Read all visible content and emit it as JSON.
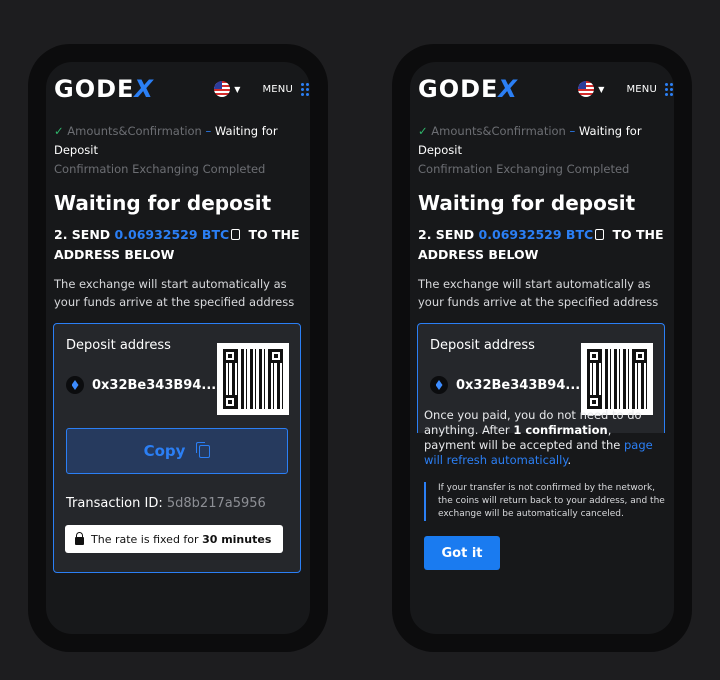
{
  "brand": {
    "logo_main": "GODE",
    "logo_accent": "X"
  },
  "header": {
    "menu_label": "MENU",
    "language_flag": "us-flag-icon"
  },
  "steps": {
    "step1": "Amounts&Confirmation",
    "step2": "Waiting for Deposit",
    "step3": "Confirmation",
    "step4": "Exchanging",
    "step5": "Completed"
  },
  "page": {
    "title": "Waiting for deposit",
    "send_prefix": "2. SEND",
    "amount": "0.06932529 BTC",
    "send_suffix": "TO THE",
    "send_suffix2": "ADDRESS BELOW",
    "description": "The exchange will start automatically as your funds arrive at the specified address"
  },
  "deposit": {
    "label": "Deposit address",
    "address": "0x32Be343B94...",
    "copy_label": "Copy",
    "tx_label": "Transaction ID:",
    "tx_value": "5d8b217a5956",
    "rate_prefix": "The rate is fixed for",
    "rate_bold": "30 minutes"
  },
  "notice": {
    "p1": "Once you paid, you do not need to do anything. After",
    "p1_bold": "1 confirmation",
    "p1_cont": ", payment will be accepted and the",
    "p1_link": "page will refresh automatically",
    "p1_end": ".",
    "warning": "If your transfer is not confirmed by the network, the coins will return back to your address, and the exchange will be automatically canceled.",
    "button": "Got it"
  },
  "colors": {
    "accent": "#2b7ff5",
    "check": "#2fb46a",
    "background": "#17181a"
  }
}
